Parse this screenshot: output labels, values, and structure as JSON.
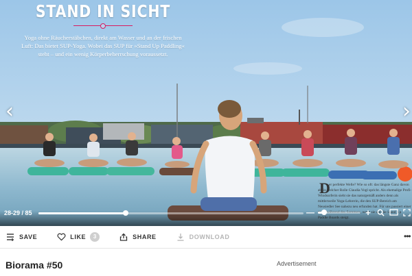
{
  "article": {
    "headline": "STAND IN SICHT",
    "lead": "Yoga ohne Räucherstäbchen, direkt am Wasser und an der frischen Luft: Das bietet SUP-Yoga. Wobei das SUP für »Stand Up Paddling« steht – und ein wenig Körperbeherrschung voraussetzt.",
    "dropcap": "D",
    "body": "er perfekte Welle? Wie so oft: das längste Ganz davon ab, in welcher Rolle Claudia Vogl spricht. Als ehemalige Profi-Windsurferin sieht sie das naturgemäß anders denn als mittlerweile Yoga-Lehrerin, die den SUP-Bereich am Neusiedler See nahezu neu erfunden hat. Für uns passiert einer meist während des Sommers, wenn sie auf die Stand Up Paddle Boards steigt."
  },
  "viewer": {
    "prev_arrow": "‹",
    "next_arrow": "›",
    "page_counter": "28-29 / 85",
    "progress": 0.33,
    "zoom_level": 0.14,
    "zoom_minus": "—",
    "zoom_plus": "+"
  },
  "toolbar": {
    "save_label": "SAVE",
    "like_label": "LIKE",
    "like_count": "3",
    "share_label": "SHARE",
    "download_label": "DOWNLOAD",
    "more": "•••"
  },
  "publication": {
    "title": "Biorama #50"
  },
  "sidebar": {
    "ad_label": "Advertisement"
  },
  "colors": {
    "accent": "#d9195f",
    "sky": "#a9cdea",
    "lake": "#8ab7d0",
    "board": "#3fb59b"
  },
  "icons": [
    "save-icon",
    "like-icon",
    "share-icon",
    "download-icon",
    "zoom-in-icon",
    "search-icon",
    "single-page-icon",
    "fullscreen-icon",
    "more-icon"
  ]
}
